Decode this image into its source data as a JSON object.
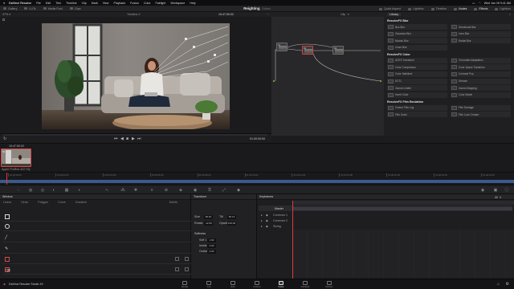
{
  "menubar": {
    "app": "DaVinci Resolve",
    "items": [
      "File",
      "Edit",
      "Trim",
      "Timeline",
      "Clip",
      "Mark",
      "View",
      "Playback",
      "Fusion",
      "Color",
      "Fairlight",
      "Workspace",
      "Help"
    ],
    "clock": "Wed Jan 28 9:41 AM"
  },
  "toolbar": {
    "left": [
      "Gallery",
      "LUTs",
      "Media Pool",
      "Clips"
    ],
    "project_title": "Reighting",
    "project_status": "Edited",
    "right": [
      "Quick Aspect",
      "Lightbox",
      "Timeline",
      "Nodes",
      "Effects",
      "Lightbox"
    ]
  },
  "viewer": {
    "zoom": "37%",
    "timeline_name": "Timeline 2",
    "timecode": "15:47:50:02",
    "end_timecode": "01:00:00:00"
  },
  "node_editor": {
    "mode": "Clip",
    "nodes": [
      {
        "num": "01",
        "selected": false
      },
      {
        "num": "02",
        "selected": true
      },
      {
        "num": "03",
        "selected": false
      }
    ]
  },
  "library": {
    "tab": "Library",
    "sections": [
      {
        "title": "ResolveFX Blur",
        "items": [
          "Box Blur",
          "Directional Blur",
          "Gaussian Blur",
          "Lens Blur",
          "Mosaic Blur",
          "Radial Blur",
          "Zoom Blur"
        ]
      },
      {
        "title": "ResolveFX Color",
        "items": [
          "ACES Transform",
          "Chromatic Adaptation",
          "Color Compressor",
          "Color Space Transform",
          "Color Stabilizer",
          "Contrast Pop",
          "DCTL",
          "Dehaze",
          "Gamut Limiter",
          "Gamut Mapping",
          "Invert Color",
          "Color Match"
        ]
      },
      {
        "title": "ResolveFX Film Emulation",
        "items": [
          "Cineon Film Log",
          "Film Damage",
          "Film Grain",
          "Film Look Creator"
        ]
      }
    ]
  },
  "clip_strip": {
    "clip_tc": "15:47:50:02",
    "clip_num": "01",
    "clip_name": "Apple ProRes 422 HQ"
  },
  "mini_timeline": {
    "ticks": [
      "01:00:00:00",
      "01:00:02:00",
      "01:00:04:00",
      "01:00:06:00",
      "01:00:08:00",
      "01:00:10:00",
      "01:00:12:00",
      "01:00:14:00",
      "01:00:16:00",
      "01:00:18:00",
      "01:00:20:00"
    ]
  },
  "window_panel": {
    "title": "Window",
    "shape_tabs": [
      "Linear",
      "Circle",
      "Polygon",
      "Curve",
      "Gradient"
    ],
    "delete_label": "Delete",
    "shapes": [
      "Square",
      "Circle",
      "Line",
      "Pen",
      "Brush",
      "Erase"
    ]
  },
  "transform_panel": {
    "title": "Transform",
    "fields": [
      {
        "label": "Size",
        "value": "50.81",
        "label2": "Tilt",
        "value2": "50.13"
      },
      {
        "label": "Rotate",
        "value": "-12.96",
        "label2": "Opacity",
        "value2": "100.00"
      }
    ],
    "softness_title": "Softness",
    "softness": [
      {
        "label": "Soft 1",
        "value": "1.92"
      },
      {
        "label": "Inside",
        "value": "0.00"
      },
      {
        "label": "Outside",
        "value": "0.00"
      }
    ]
  },
  "keyframes_panel": {
    "title": "Keyframes",
    "mode": "All",
    "rows": [
      "Master",
      "Corrector 1",
      "Corrector 2",
      "Sizing"
    ]
  },
  "pages": {
    "items": [
      "Media",
      "Cut",
      "Edit",
      "Fusion",
      "Color",
      "Fairlight",
      "Deliver"
    ],
    "active": "Color",
    "brand": "DaVinci Resolve Studio 19"
  },
  "colors": {
    "accent_red": "#d24a4a",
    "playhead": "#e23a3a",
    "timeline_blue": "#3a5a8a"
  }
}
